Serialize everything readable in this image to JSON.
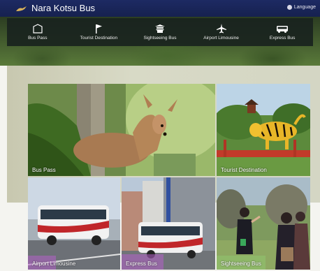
{
  "header": {
    "title": "Nara Kotsu Bus",
    "language": "Language",
    "logo_icon": "deer-logo-icon"
  },
  "nav": {
    "items": [
      {
        "label": "Bus Pass",
        "icon": "bus-pass-icon"
      },
      {
        "label": "Tourist Destination",
        "icon": "flag-icon"
      },
      {
        "label": "Sightseeing Bus",
        "icon": "temple-icon"
      },
      {
        "label": "Airport Limousine",
        "icon": "airplane-icon"
      },
      {
        "label": "Express Bus",
        "icon": "bus-icon"
      }
    ]
  },
  "tiles": {
    "bus_pass": "Bus Pass",
    "tourist_destination": "Tourist Destination",
    "airport_limousine": "Airport Limousine",
    "express_bus": "Express Bus",
    "sightseeing_bus": "Sightseeing Bus"
  },
  "colors": {
    "topbar": "#1d2a63",
    "navbar": "#19231e",
    "label_accent": "#9b3fae"
  }
}
